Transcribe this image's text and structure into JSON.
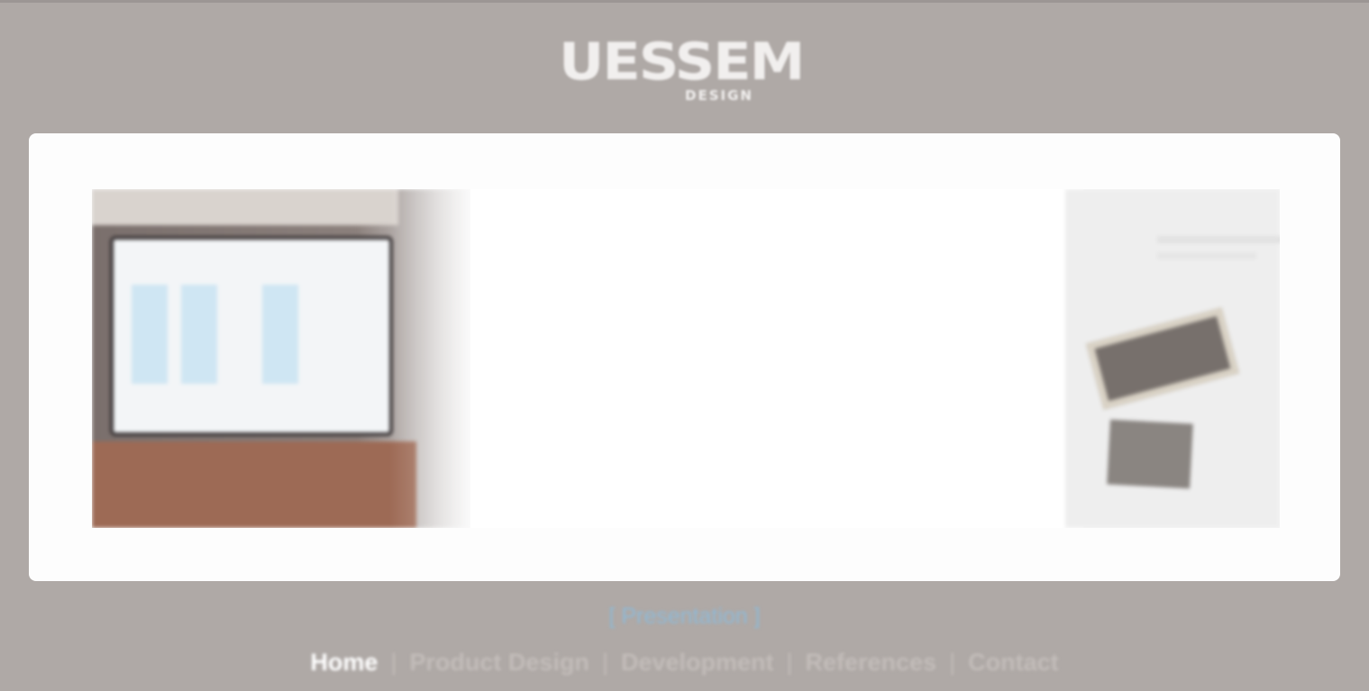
{
  "logo": {
    "main_text": "UESSEM",
    "sub_text": "DESIGN"
  },
  "slider": {
    "caption_top_left": "",
    "caption_top_right": "",
    "caption_bottom_left": "",
    "caption_bottom_right": ""
  },
  "tagline": "[ Presentation ]",
  "nav": {
    "items": [
      {
        "label": "Home",
        "active": true
      },
      {
        "label": "Product Design",
        "active": false
      },
      {
        "label": "Development",
        "active": false
      },
      {
        "label": "References",
        "active": false
      },
      {
        "label": "Contact",
        "active": false
      }
    ],
    "separator": "|"
  },
  "colors": {
    "background": "#afa9a6",
    "panel": "#fdfdfd",
    "tagline": "#8fb9d6",
    "nav_active": "#ffffff",
    "nav_inactive": "#c2bcb9"
  }
}
